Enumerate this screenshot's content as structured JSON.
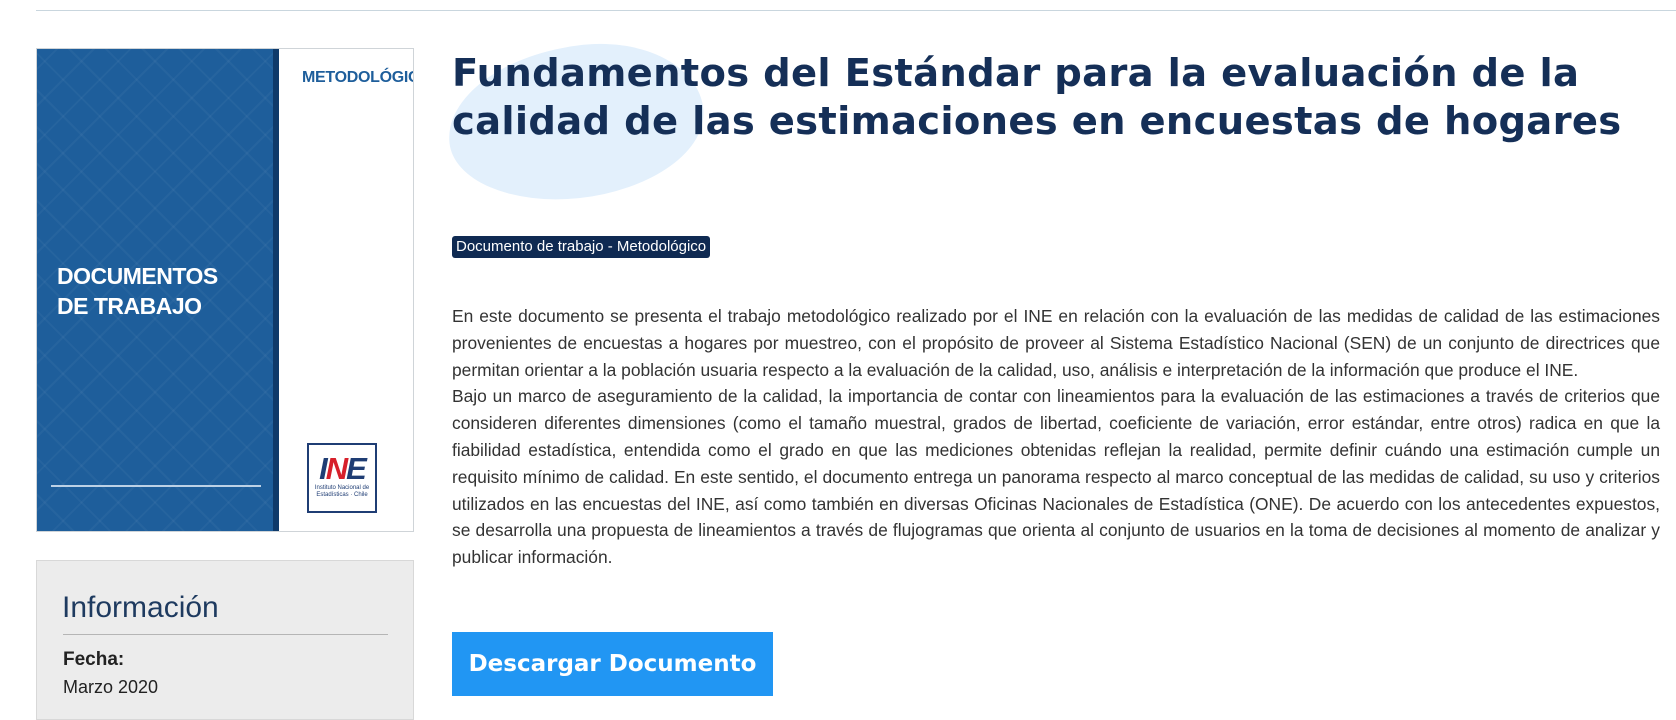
{
  "cover": {
    "tag": "METODOLÓGICO",
    "title": "DOCUMENTOS\nDE TRABAJO",
    "logo_text": "INE",
    "logo_subtitle": "Instituto Nacional de Estadísticas · Chile"
  },
  "info": {
    "heading": "Información",
    "fecha_label": "Fecha:",
    "fecha_value": "Marzo 2020"
  },
  "main": {
    "title": "Fundamentos del Estándar para la evaluación de la calidad de las estimaciones en encuestas de hogares",
    "badge": "Documento de trabajo - Metodológico",
    "paragraphs": [
      "En este documento se presenta el trabajo metodológico realizado por el INE en relación con la evaluación de las medidas de calidad de las estimaciones provenientes de encuestas a hogares por muestreo, con el propósito de proveer al Sistema Estadístico Nacional (SEN) de un conjunto de directrices que permitan orientar a la población usuaria respecto a la evaluación de la calidad, uso, análisis e interpretación de la información que produce el INE.",
      "Bajo un marco de aseguramiento de la calidad, la importancia de contar con lineamientos para la evaluación de las estimaciones a través de criterios que consideren diferentes dimensiones (como el tamaño muestral, grados de libertad, coeficiente de variación, error estándar, entre otros) radica en que la fiabilidad estadística, entendida como el grado en que las mediciones obtenidas reflejan la realidad, permite definir cuándo una estimación cumple un requisito mínimo de calidad. En este sentido, el documento entrega un panorama respecto al marco conceptual de las medidas de calidad, su uso y criterios utilizados en las encuestas del INE, así como también en diversas Oficinas Nacionales de Estadística (ONE). De acuerdo con los antecedentes expuestos, se desarrolla una propuesta de lineamientos a través de flujogramas que orienta al conjunto de usuarios en la toma de decisiones al momento de analizar y publicar información."
    ],
    "download_label": "Descargar Documento"
  },
  "colors": {
    "title": "#152f57",
    "badge_bg": "#0f2a52",
    "button_bg": "#2196f3",
    "cover_blue": "#1e5e9b",
    "logo_red": "#d7202b"
  }
}
